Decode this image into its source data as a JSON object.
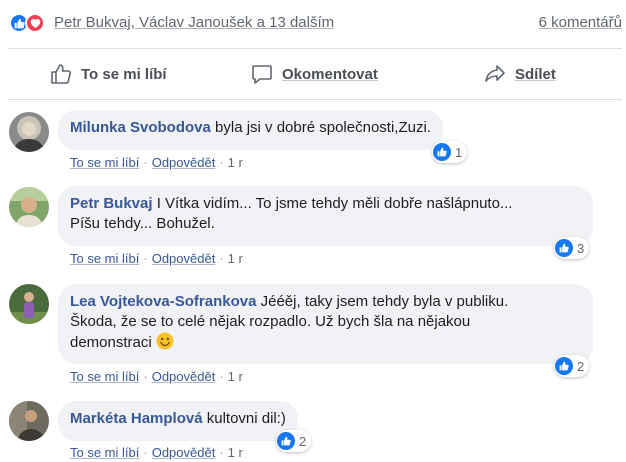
{
  "summary": {
    "reaction_icons": [
      "like-icon",
      "love-icon"
    ],
    "names": "Petr Bukvaj, Václav Janoušek a 13 dalším",
    "comments_count": "6 komentářů"
  },
  "actions": {
    "like": "To se mi líbí",
    "comment": "Okomentovat",
    "share": "Sdílet"
  },
  "comments": [
    {
      "author": "Milunka Svobodova",
      "text": "byla jsi v dobré společnosti,Zuzi.",
      "like": "To se mi líbí",
      "reply": "Odpovědět",
      "time": "1 r",
      "reaction_count": "1"
    },
    {
      "author": "Petr Bukvaj",
      "text_line1": "I Vítka vidím... To jsme tehdy měli dobře našlápnuto...",
      "text_line2": "Píšu tehdy... Bohužel.",
      "like": "To se mi líbí",
      "reply": "Odpovědět",
      "time": "1 r",
      "reaction_count": "3"
    },
    {
      "author": "Lea Vojtekova-Sofrankova",
      "text_line1": "Jééěj, taky jsem tehdy byla v publiku.",
      "text_line2": "Škoda, že se to celé nějak rozpadlo. Už bych šla na nějakou",
      "text_line3": "demonstraci",
      "like": "To se mi líbí",
      "reply": "Odpovědět",
      "time": "1 r",
      "reaction_count": "2"
    },
    {
      "author": "Markéta Hamplová",
      "text": "kultovni dil:)",
      "like": "To se mi líbí",
      "reply": "Odpovědět",
      "time": "1 r",
      "reaction_count": "2"
    }
  ],
  "colors": {
    "link_blue": "#385898",
    "facebook_blue": "#1877f2",
    "love_red": "#f33e58",
    "bubble_gray": "#f0f2f5"
  }
}
